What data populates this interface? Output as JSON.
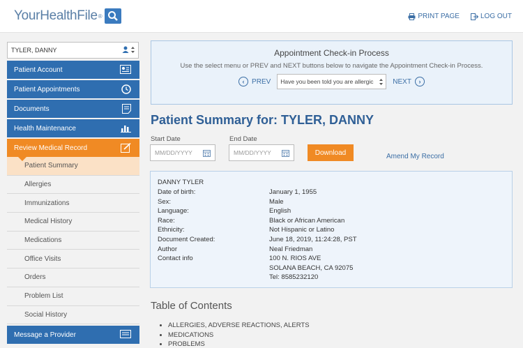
{
  "header": {
    "logo_text": "YourHealthFile",
    "logo_reg": "®",
    "print_label": "PRINT PAGE",
    "logout_label": "LOG OUT"
  },
  "sidebar": {
    "patient_select_value": "TYLER, DANNY",
    "nav": [
      {
        "label": "Patient Account",
        "icon": "id-card-icon"
      },
      {
        "label": "Patient Appointments",
        "icon": "clock-icon"
      },
      {
        "label": "Documents",
        "icon": "document-icon"
      },
      {
        "label": "Health Maintenance",
        "icon": "bar-chart-icon"
      },
      {
        "label": "Review Medical Record",
        "icon": "edit-icon"
      }
    ],
    "sub_items": [
      "Patient Summary",
      "Allergies",
      "Immunizations",
      "Medical History",
      "Medications",
      "Office Visits",
      "Orders",
      "Problem List",
      "Social History"
    ],
    "message_provider": "Message a Provider"
  },
  "checkin": {
    "title": "Appointment Check-in Process",
    "description": "Use the select menu or PREV and NEXT buttons below to navigate the Appointment Check-in Process.",
    "prev_label": "PREV",
    "next_label": "NEXT",
    "select_value": "Have you been told you are allergic"
  },
  "summary": {
    "title": "Patient Summary for: TYLER, DANNY",
    "start_date_label": "Start Date",
    "end_date_label": "End Date",
    "date_placeholder": "MM/DD/YYYY",
    "download_label": "Download",
    "amend_label": "Amend My Record"
  },
  "patient_info": {
    "name": "DANNY TYLER",
    "rows": [
      {
        "k": "Date of birth:",
        "v": "January 1, 1955"
      },
      {
        "k": "Sex:",
        "v": "Male"
      },
      {
        "k": "Language:",
        "v": "English"
      },
      {
        "k": "Race:",
        "v": "Black or African American"
      },
      {
        "k": "Ethnicity:",
        "v": "Not Hispanic or Latino"
      },
      {
        "k": "Document Created:",
        "v": "June 18, 2019, 11:24:28, PST"
      },
      {
        "k": "Author",
        "v": "Neal Friedman"
      },
      {
        "k": "Contact info",
        "v": "100 N. RIOS AVE"
      },
      {
        "k": "",
        "v": "SOLANA BEACH, CA 92075"
      },
      {
        "k": "",
        "v": "Tel: 8585232120"
      }
    ]
  },
  "toc": {
    "title": "Table of Contents",
    "items": [
      "ALLERGIES, ADVERSE REACTIONS, ALERTS",
      "MEDICATIONS",
      "PROBLEMS"
    ]
  },
  "colors": {
    "primary_blue": "#2f6eb0",
    "accent_orange": "#f08a24",
    "title_blue": "#2f5f96"
  }
}
